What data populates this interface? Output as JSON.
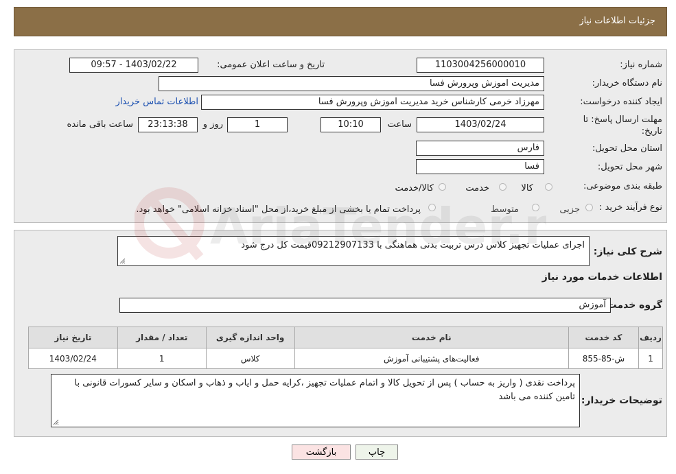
{
  "header": {
    "title": "جزئیات اطلاعات نیاز"
  },
  "form": {
    "need_number_label": "شماره نیاز:",
    "need_number": "1103004256000010",
    "announce_label": "تاریخ و ساعت اعلان عمومی:",
    "announce_value": "1403/02/22 - 09:57",
    "buyer_org_label": "نام دستگاه خریدار:",
    "buyer_org": "مدیریت اموزش وپرورش فسا",
    "creator_label": "ایجاد کننده درخواست:",
    "creator": "مهرزاد خرمی کارشناس خرید مدیریت اموزش وپرورش فسا",
    "contact_link": "اطلاعات تماس خریدار",
    "deadline_label_1": "مهلت ارسال پاسخ: تا",
    "deadline_label_2": "تاریخ:",
    "deadline_date": "1403/02/24",
    "time_label": "ساعت",
    "deadline_time": "10:10",
    "days_value": "1",
    "days_label": "روز و",
    "remaining_time": "23:13:38",
    "remaining_label": "ساعت باقی مانده",
    "province_label": "استان محل تحویل:",
    "province": "فارس",
    "city_label": "شهر محل تحویل:",
    "city": "فسا",
    "category_label": "طبقه بندی موضوعی:",
    "category_options": [
      "کالا",
      "خدمت",
      "کالا/خدمت"
    ],
    "process_label": "نوع فرآیند خرید :",
    "process_options": [
      "جزیی",
      "متوسط"
    ],
    "payment_note": "پرداخت تمام یا بخشی از مبلغ خرید،از محل \"اسناد خزانه اسلامی\" خواهد بود."
  },
  "details": {
    "summary_label": "شرح کلی نیاز:",
    "summary": "اجرای عملیات تجهیز کلاس درس تربیت بدنی هماهنگی با 09212907133قیمت کل درج شود",
    "services_title": "اطلاعات خدمات مورد نیاز",
    "service_group_label": "گروه خدمت:",
    "service_group": "آموزش",
    "table": {
      "headers": [
        "ردیف",
        "کد خدمت",
        "نام خدمت",
        "واحد اندازه گیری",
        "تعداد / مقدار",
        "تاریخ نیاز"
      ],
      "rows": [
        [
          "1",
          "ش-85-855",
          "فعالیت‌های پشتیبانی آموزش",
          "کلاس",
          "1",
          "1403/02/24"
        ]
      ]
    },
    "buyer_notes_label": "توضیحات خریدار:",
    "buyer_notes": "پرداخت نقدی ( واریز به حساب ) پس از تحویل کالا و اتمام عملیات تجهیز ،کرایه حمل و ایاب و ذهاب و اسکان و سایر کسورات قانونی با تامین کننده می باشد"
  },
  "buttons": {
    "print": "چاپ",
    "back": "بازگشت"
  },
  "watermark": {
    "text": "AriaTender.neT"
  }
}
